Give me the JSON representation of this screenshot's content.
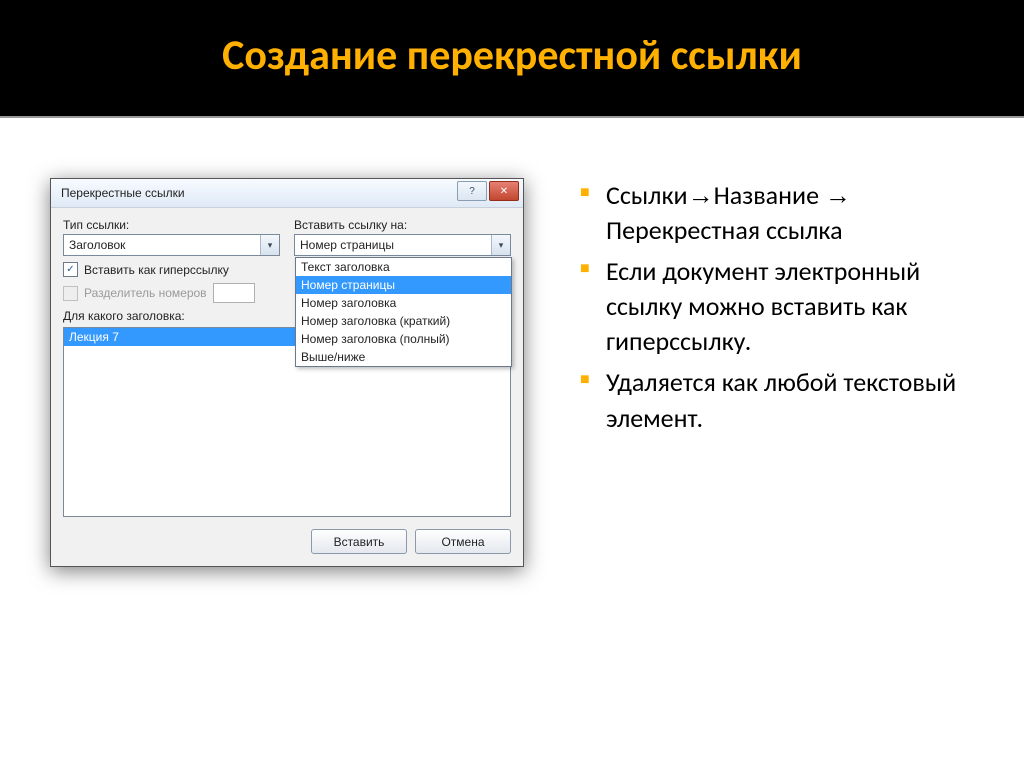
{
  "slide": {
    "title": "Создание перекрестной ссылки"
  },
  "bullets": {
    "b1_a": "Ссылки",
    "b1_b": "Название",
    "b1_c": " Перекрестная ссылка",
    "b2": "Если документ электронный ссылку можно вставить как гиперссылку.",
    "b3": "Удаляется как любой текстовый элемент.",
    "arrow": "→"
  },
  "dialog": {
    "title": "Перекрестные ссылки",
    "close_glyph": "✕",
    "help_glyph": "?",
    "labels": {
      "type": "Тип ссылки:",
      "insert_on": "Вставить ссылку на:",
      "as_hyperlink": "Вставить как гиперссылку",
      "as_hyperlink_accel": "г",
      "number_sep": "Разделитель номеров",
      "for_heading": "Для какого заголовка:"
    },
    "type_value": "Заголовок",
    "insert_value": "Номер страницы",
    "chk_hyperlink": "✓",
    "options": {
      "o0": "Текст заголовка",
      "o1": "Номер страницы",
      "o2": "Номер заголовка",
      "o3": "Номер заголовка (краткий)",
      "o4": "Номер заголовка (полный)",
      "o5": "Выше/ниже"
    },
    "list": {
      "i0": "Лекция 7"
    },
    "buttons": {
      "insert": "Вставить",
      "cancel": "Отмена"
    }
  }
}
